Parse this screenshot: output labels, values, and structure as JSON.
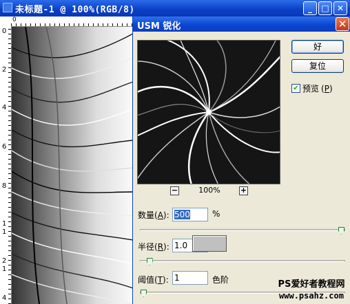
{
  "document": {
    "title": "未标题-1 @ 100%(RGB/8)",
    "window_buttons": {
      "minimize": "_",
      "maximize": "□",
      "close": "✕"
    },
    "ruler_top": [
      "0"
    ],
    "ruler_left": [
      "0",
      "2",
      "4",
      "6",
      "8",
      "1",
      "1",
      "2",
      "1",
      "4"
    ]
  },
  "dialog": {
    "title": "USM 锐化",
    "close_glyph": "✕",
    "ok_label": "好",
    "reset_label": "复位",
    "preview_label": "预览",
    "preview_key": "P",
    "preview_checked": true,
    "zoom_minus": "−",
    "zoom_plus": "+",
    "zoom_level": "100%",
    "amount": {
      "label": "数量",
      "key": "A",
      "value": "500",
      "unit": "%",
      "slider_fraction": 1.0
    },
    "radius": {
      "label": "半径",
      "key": "R",
      "value": "1.0",
      "unit": "",
      "slider_fraction": 0.03
    },
    "threshold": {
      "label": "阈值",
      "key": "T",
      "value": "1",
      "unit": "色阶",
      "slider_fraction": 0.0
    }
  },
  "watermark": {
    "line1": "PS爱好者教程网",
    "line2": "www.psahz.com"
  },
  "colors": {
    "title_blue": "#0a3fc6",
    "dialog_bg": "#ece9d8",
    "selection": "#316ac5"
  }
}
